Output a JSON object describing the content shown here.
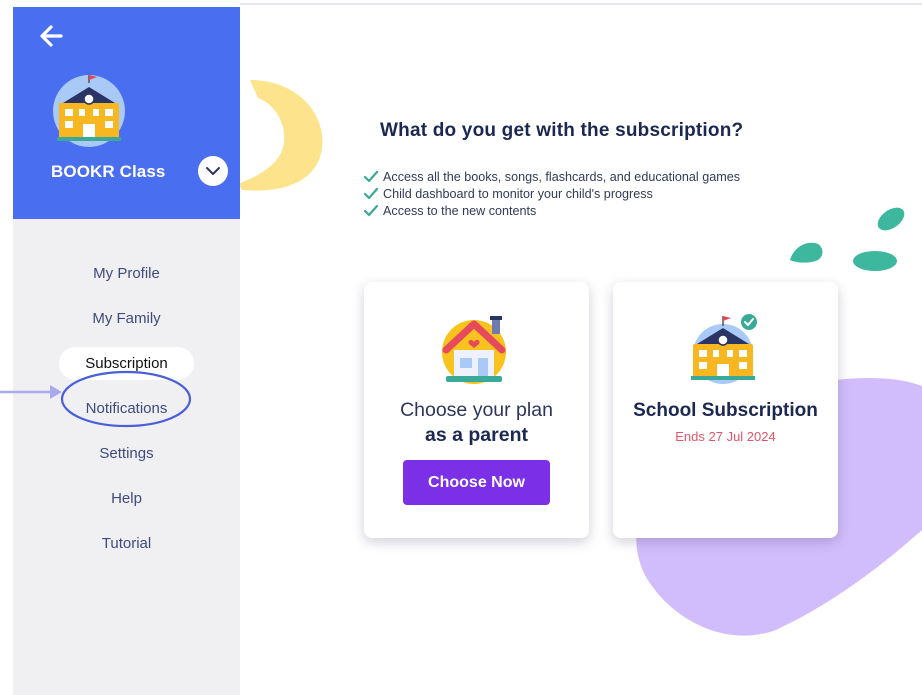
{
  "sidebar": {
    "class_name": "BOOKR Class",
    "items": [
      {
        "label": "My Profile"
      },
      {
        "label": "My Family"
      },
      {
        "label": "Subscription"
      },
      {
        "label": "Notifications"
      },
      {
        "label": "Settings"
      },
      {
        "label": "Help"
      },
      {
        "label": "Tutorial"
      }
    ],
    "active_item": "Subscription",
    "highlighted_item": "Notifications"
  },
  "main": {
    "headline": "What do you get with the subscription?",
    "benefits": [
      "Access all the books, songs, flashcards, and educational games",
      "Child dashboard to monitor your child's progress",
      "Access to the new contents"
    ],
    "parent_card": {
      "line1": "Choose your plan",
      "line2": "as a parent",
      "button_label": "Choose Now"
    },
    "school_card": {
      "title": "School Subscription",
      "status": "Ends 27 Jul 2024"
    }
  },
  "icons": {
    "back": "arrow-left-icon",
    "dropdown": "chevron-down-icon",
    "check": "checkmark-icon",
    "avatar": "school-building-icon",
    "parent": "house-icon",
    "school": "school-building-check-icon"
  },
  "colors": {
    "primary_blue": "#4a6ef0",
    "button_purple": "#7b2fe6",
    "sidebar_bg": "#f0f0f3",
    "heading_navy": "#1c2752",
    "check_teal": "#3aa99a",
    "ends_red": "#e0556a",
    "annotation_blue": "#4a5fd9",
    "blob_lavender": "#d2bdfc",
    "arc_yellow": "#fde48c",
    "drop_teal": "#3db89f"
  }
}
